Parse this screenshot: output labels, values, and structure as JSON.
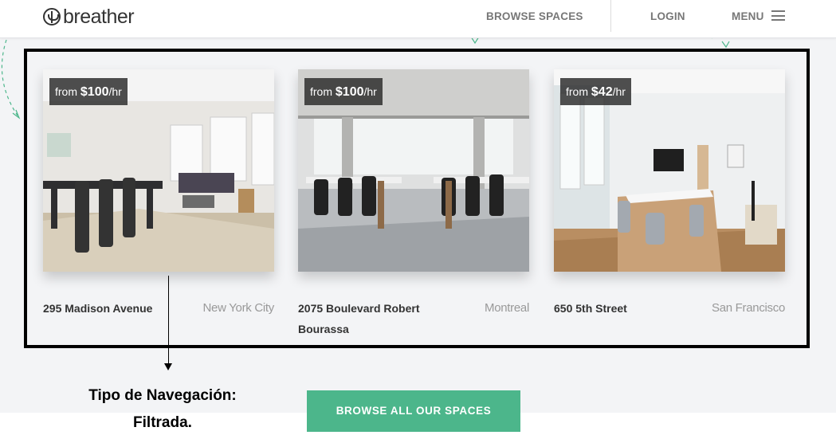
{
  "header": {
    "logo_text": "breather",
    "nav": {
      "browse_label": "BROWSE SPACES",
      "login_label": "LOGIN",
      "menu_label": "MENU"
    }
  },
  "listings": [
    {
      "price_prefix": "from ",
      "price": "$100",
      "price_suffix": "/hr",
      "address": "295 Madison Avenue",
      "city": "New York City"
    },
    {
      "price_prefix": "from ",
      "price": "$100",
      "price_suffix": "/hr",
      "address": "2075 Boulevard Robert Bourassa",
      "city": "Montreal"
    },
    {
      "price_prefix": "from ",
      "price": "$42",
      "price_suffix": "/hr",
      "address": "650 5th Street",
      "city": "San Francisco"
    }
  ],
  "annotation": {
    "line1": "Tipo de Navegación:",
    "line2": "Filtrada."
  },
  "cta": {
    "label": "BROWSE ALL OUR SPACES"
  },
  "colors": {
    "accent": "#4cb68b",
    "frame": "#000000",
    "badge_bg": "#282828"
  },
  "icons": {
    "logo": "tree-circle-icon",
    "menu": "hamburger-icon"
  }
}
